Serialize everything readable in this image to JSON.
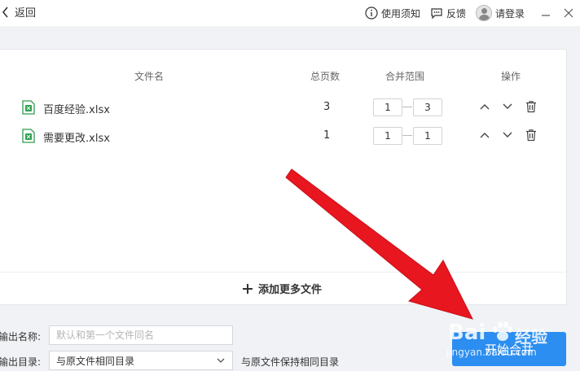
{
  "header": {
    "back_label": "返回",
    "links": [
      {
        "label": "使用须知",
        "icon": "info-icon"
      },
      {
        "label": "反馈",
        "icon": "feedback-icon"
      },
      {
        "label": "请登录",
        "icon": "avatar-icon"
      }
    ]
  },
  "table": {
    "columns": [
      "文件名",
      "总页数",
      "合并范围",
      "操作"
    ],
    "rows": [
      {
        "name": "百度经验.xlsx",
        "pages": "3",
        "from": "1",
        "to": "3"
      },
      {
        "name": "需要更改.xlsx",
        "pages": "1",
        "from": "1",
        "to": "1"
      }
    ],
    "add_more_label": "添加更多文件"
  },
  "form": {
    "output_name_label": "输出名称:",
    "output_name_placeholder": "默认和第一个文件同名",
    "output_dir_label": "输出目录:",
    "output_dir_value": "与原文件相同目录",
    "output_dir_hint": "与原文件保持相同目录"
  },
  "actions": {
    "start_label": "开始合并"
  },
  "watermark": {
    "brand": "Bai",
    "brand2": "经验",
    "url": "jingyan.baidu.com"
  },
  "colors": {
    "accent": "#2b8ef0",
    "excel_green": "#2e9e4f",
    "arrow_red": "#e8161e"
  }
}
